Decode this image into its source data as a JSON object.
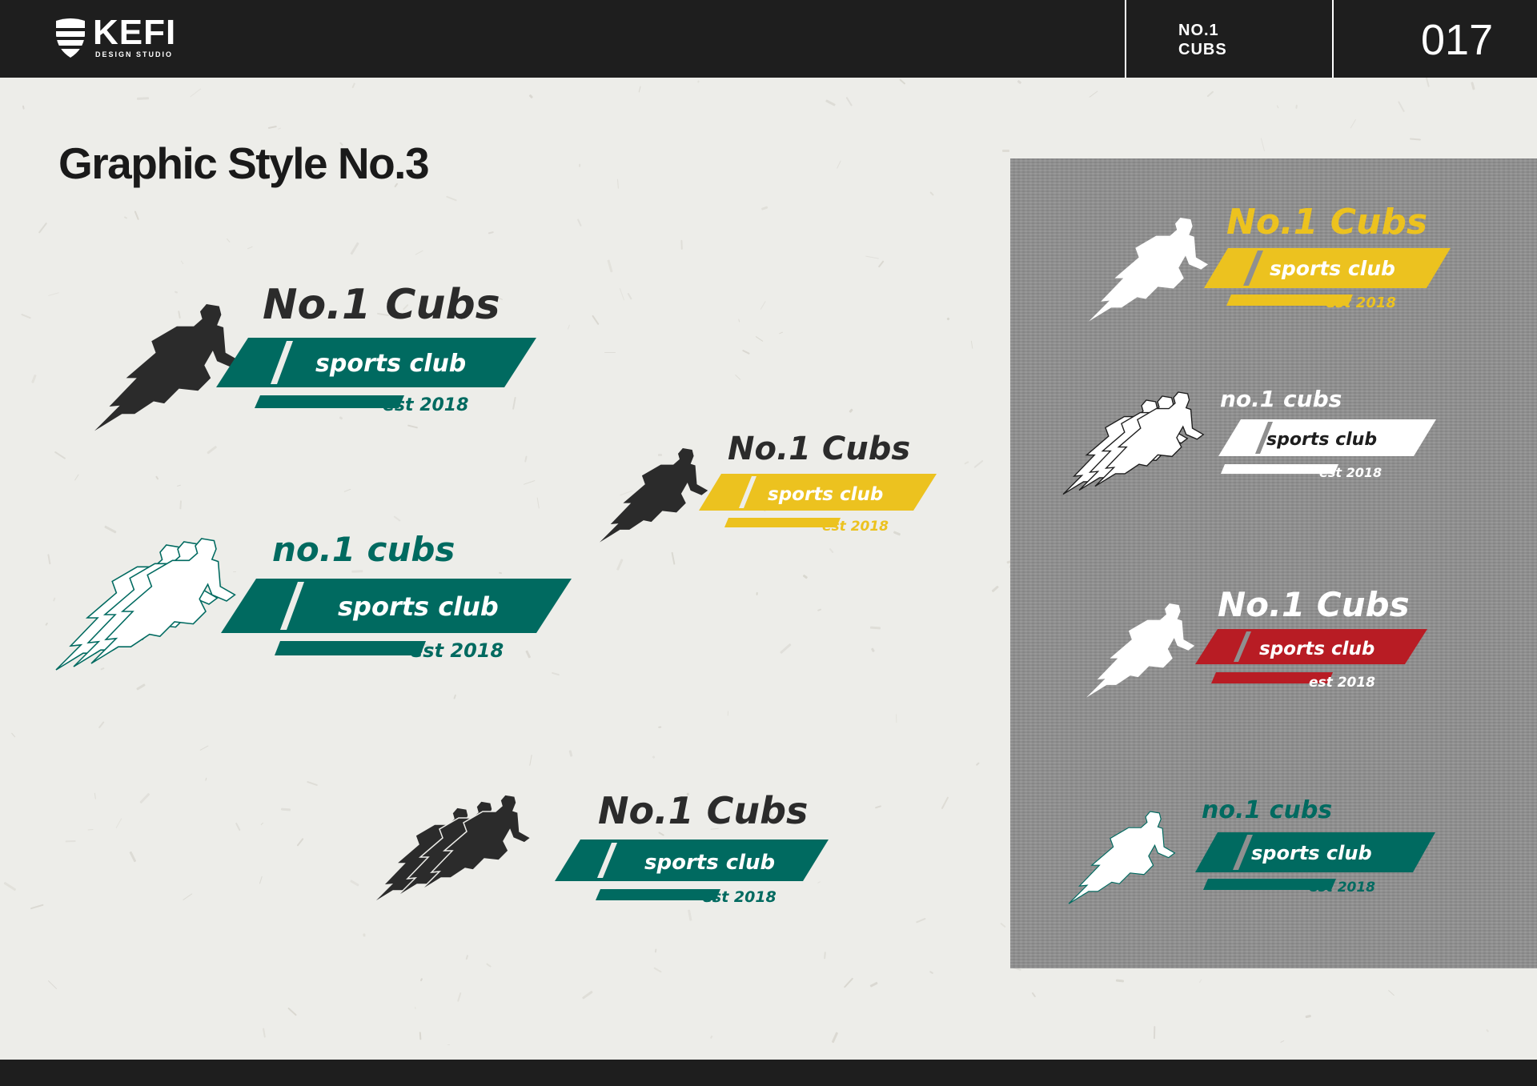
{
  "header": {
    "brand_name": "KEFI",
    "brand_sub": "DESIGN STUDIO",
    "project_line1": "NO.1",
    "project_line2": "CUBS",
    "page_number": "017"
  },
  "title": "Graphic Style No.3",
  "colors": {
    "header_bg": "#1e1e1e",
    "paper_bg": "#edede9",
    "panel_gray": "#8f8f8f",
    "green": "#006a60",
    "yellow": "#ecc21f",
    "red": "#b81c24",
    "dark": "#2b2b2b",
    "white": "#ffffff"
  },
  "logos": [
    {
      "name": "No.1 Cubs",
      "tagline": "sports club",
      "est": "est 2018",
      "variant": "single dark runner, green bars"
    },
    {
      "name": "No.1 Cubs",
      "tagline": "sports club",
      "est": "est 2018",
      "variant": "single dark runner, yellow bars"
    },
    {
      "name": "no.1 cubs",
      "tagline": "sports club",
      "est": "est 2018",
      "variant": "triple outlined runners, green bars"
    },
    {
      "name": "No.1 Cubs",
      "tagline": "sports club",
      "est": "est 2018",
      "variant": "triple dark runners, green bars"
    },
    {
      "name": "No.1 Cubs",
      "tagline": "sports club",
      "est": "est 2018",
      "variant": "white runner, yellow bars on gray"
    },
    {
      "name": "no.1 cubs",
      "tagline": "sports club",
      "est": "est 2018",
      "variant": "triple outlined runners, white bars on gray"
    },
    {
      "name": "No.1 Cubs",
      "tagline": "sports club",
      "est": "est 2018",
      "variant": "white runner, red bars on gray"
    },
    {
      "name": "no.1 cubs",
      "tagline": "sports club",
      "est": "est 2018",
      "variant": "white runner, green bars on gray"
    }
  ]
}
